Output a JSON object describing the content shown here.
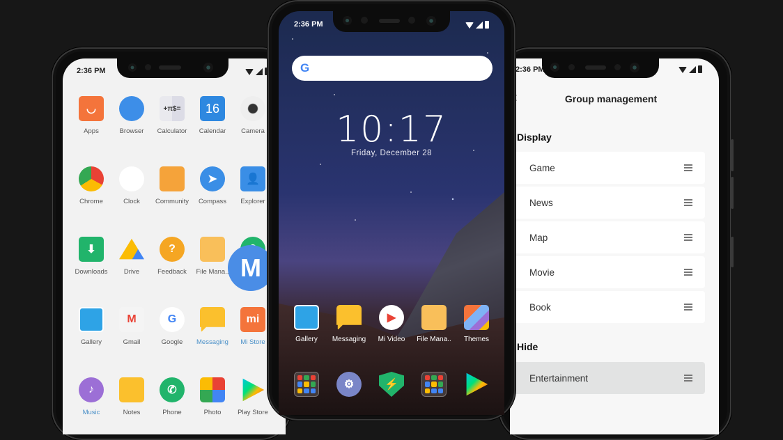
{
  "status_bar": {
    "time": "2:36 PM"
  },
  "left_phone": {
    "apps": [
      {
        "label": "Apps",
        "icon": "mi-apps-icon",
        "color": "#f4743b",
        "highlight": false
      },
      {
        "label": "Browser",
        "icon": "browser-icon",
        "color": "#3d8ee8",
        "highlight": false
      },
      {
        "label": "Calculator",
        "icon": "calculator-icon",
        "color": "#f5a623",
        "highlight": false
      },
      {
        "label": "Calendar",
        "icon": "calendar-icon",
        "color": "#2e88e0",
        "highlight": false,
        "glyph": "16"
      },
      {
        "label": "Camera",
        "icon": "camera-icon",
        "color": "#dcdcdc",
        "highlight": false
      },
      {
        "label": "Chrome",
        "icon": "chrome-icon",
        "color": "#e94235",
        "highlight": false
      },
      {
        "label": "Clock",
        "icon": "clock-icon",
        "color": "#ffffff",
        "highlight": false
      },
      {
        "label": "Community",
        "icon": "community-icon",
        "color": "#f5a33a",
        "highlight": false
      },
      {
        "label": "Compass",
        "icon": "compass-icon",
        "color": "#3a8ee6",
        "highlight": false
      },
      {
        "label": "Explorer",
        "icon": "explorer-icon",
        "color": "#3a8ee6",
        "highlight": false
      },
      {
        "label": "Downloads",
        "icon": "downloads-icon",
        "color": "#21b46b",
        "highlight": false
      },
      {
        "label": "Drive",
        "icon": "drive-icon",
        "color": "#fbbc04",
        "highlight": false
      },
      {
        "label": "Feedback",
        "icon": "feedback-icon",
        "color": "#f5a623",
        "highlight": false,
        "glyph": "?"
      },
      {
        "label": "File Mana..",
        "icon": "folder-icon",
        "color": "#f9bf5a",
        "highlight": false
      },
      {
        "label": "",
        "icon": "location-icon",
        "color": "#21b46b",
        "highlight": false
      },
      {
        "label": "Gallery",
        "icon": "gallery-icon",
        "color": "#2ea3e6",
        "highlight": false
      },
      {
        "label": "Gmail",
        "icon": "gmail-icon",
        "color": "#e94235",
        "highlight": false,
        "glyph": "M"
      },
      {
        "label": "Google",
        "icon": "google-icon",
        "color": "#ffffff",
        "highlight": false,
        "glyph": "G"
      },
      {
        "label": "Messaging",
        "icon": "messaging-icon",
        "color": "#fbc02d",
        "highlight": true
      },
      {
        "label": "Mi Store",
        "icon": "mi-store-icon",
        "color": "#f4743b",
        "highlight": true,
        "glyph": "mi"
      },
      {
        "label": "Music",
        "icon": "music-icon",
        "color": "#9c6fd6",
        "highlight": true
      },
      {
        "label": "Notes",
        "icon": "notes-icon",
        "color": "#fbc02d",
        "highlight": false
      },
      {
        "label": "Phone",
        "icon": "phone-icon",
        "color": "#21b46b",
        "highlight": false,
        "glyph": "✆"
      },
      {
        "label": "Photo",
        "icon": "photos-icon",
        "color": "#34a853",
        "highlight": false
      },
      {
        "label": "Play Store",
        "icon": "play-store-icon",
        "color": "#00c1f5",
        "highlight": false
      }
    ],
    "floating_badge": "M"
  },
  "center_phone": {
    "clock": "10:17",
    "date": "Friday, December 28",
    "search_logo": "G",
    "dock_apps": [
      {
        "label": "Gallery",
        "icon": "gallery-icon"
      },
      {
        "label": "Messaging",
        "icon": "messaging-icon"
      },
      {
        "label": "Mi Video",
        "icon": "mi-video-icon"
      },
      {
        "label": "File Mana..",
        "icon": "folder-icon"
      },
      {
        "label": "Themes",
        "icon": "themes-icon"
      }
    ],
    "bottom_dock": [
      {
        "icon": "google-folder-icon"
      },
      {
        "icon": "settings-icon"
      },
      {
        "icon": "security-icon"
      },
      {
        "icon": "tools-folder-icon"
      },
      {
        "icon": "play-store-icon"
      }
    ]
  },
  "right_phone": {
    "title": "Group management",
    "back_glyph": "‹",
    "display_section": "Display",
    "display_items": [
      "Game",
      "News",
      "Map",
      "Movie",
      "Book"
    ],
    "hide_section": "Hide",
    "hide_items": [
      "Entertainment"
    ]
  }
}
